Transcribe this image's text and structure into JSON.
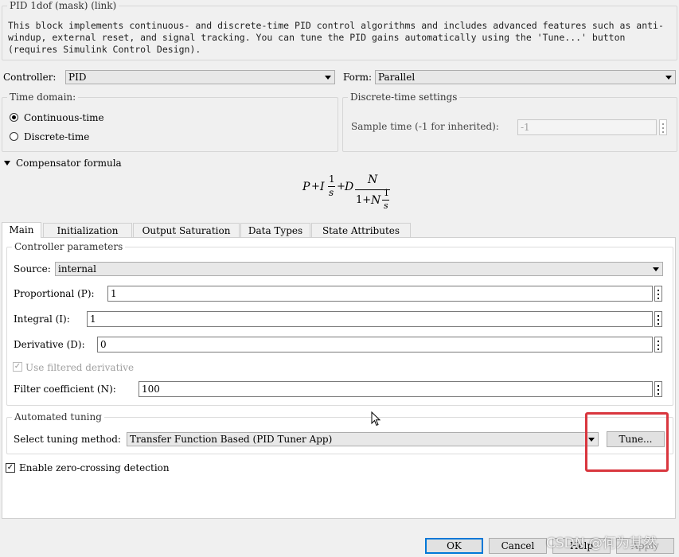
{
  "header": {
    "title": "PID 1dof (mask) (link)",
    "description": "This block implements continuous- and discrete-time PID control algorithms and includes advanced features such as anti-windup, external reset, and signal tracking. You can tune the PID gains automatically using the 'Tune...' button (requires Simulink Control Design)."
  },
  "controller": {
    "label": "Controller:",
    "value": "PID"
  },
  "form": {
    "label": "Form:",
    "value": "Parallel"
  },
  "time_domain": {
    "legend": "Time domain:",
    "options": [
      "Continuous-time",
      "Discrete-time"
    ],
    "selected": "Continuous-time"
  },
  "discrete": {
    "legend": "Discrete-time settings",
    "sample_time_label": "Sample time (-1 for inherited):",
    "sample_time_value": "-1"
  },
  "compensator": {
    "label": "Compensator formula",
    "formula": {
      "p": "P",
      "plus": "+",
      "i": "I",
      "one": "1",
      "s": "s",
      "d": "D",
      "n": "N",
      "one_plus": "1+",
      "n2": "N"
    }
  },
  "tabs": [
    "Main",
    "Initialization",
    "Output Saturation",
    "Data Types",
    "State Attributes"
  ],
  "active_tab": "Main",
  "controller_params": {
    "legend": "Controller parameters",
    "source_label": "Source:",
    "source_value": "internal",
    "proportional_label": "Proportional (P):",
    "proportional_value": "1",
    "integral_label": "Integral (I):",
    "integral_value": "1",
    "derivative_label": "Derivative (D):",
    "derivative_value": "0",
    "filtered_label": "Use filtered derivative",
    "filtered_checked": true,
    "filter_label": "Filter coefficient (N):",
    "filter_value": "100"
  },
  "auto_tuning": {
    "legend": "Automated tuning",
    "method_label": "Select tuning method:",
    "method_value": "Transfer Function Based (PID Tuner App)",
    "tune_button": "Tune..."
  },
  "zero_crossing": {
    "label": "Enable zero-crossing detection",
    "checked": true
  },
  "buttons": {
    "ok": "OK",
    "cancel": "Cancel",
    "help": "Help",
    "apply": "Apply"
  },
  "watermark": "CSDN @何为其然",
  "colors": {
    "highlight_box": "#d9363e",
    "default_button_border": "#0078d7"
  }
}
